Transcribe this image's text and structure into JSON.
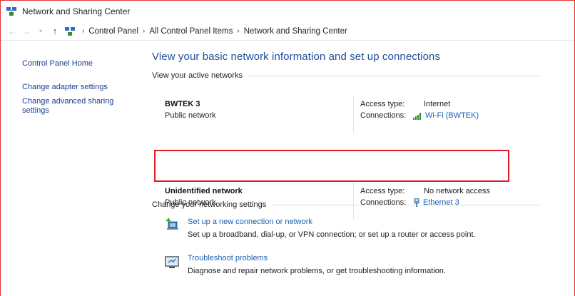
{
  "window": {
    "title": "Network and Sharing Center"
  },
  "address": {
    "crumbs": [
      "Control Panel",
      "All Control Panel Items",
      "Network and Sharing Center"
    ]
  },
  "sidebar": {
    "home": "Control Panel Home",
    "adapter": "Change adapter settings",
    "advanced_line1": "Change advanced sharing",
    "advanced_line2": "settings"
  },
  "main": {
    "title": "View your basic network information and set up connections",
    "active_heading": "View your active networks",
    "networks": [
      {
        "name": "BWTEK 3",
        "category": "Public network",
        "access_label": "Access type:",
        "access_value": "Internet",
        "connections_label": "Connections:",
        "connection_name": "Wi-Fi (BWTEK)",
        "connection_icon": "wifi-signal-icon"
      },
      {
        "name": "Unidentified network",
        "category": "Public network",
        "access_label": "Access type:",
        "access_value": "No network access",
        "connections_label": "Connections:",
        "connection_name": "Ethernet 3",
        "connection_icon": "ethernet-icon"
      }
    ],
    "change_heading": "Change your networking settings",
    "tasks": [
      {
        "title": "Set up a new connection or network",
        "desc": "Set up a broadband, dial-up, or VPN connection; or set up a router or access point.",
        "icon": "new-connection-icon"
      },
      {
        "title": "Troubleshoot problems",
        "desc": "Diagnose and repair network problems, or get troubleshooting information.",
        "icon": "troubleshoot-icon"
      }
    ]
  },
  "colors": {
    "link": "#1a5fb4",
    "title": "#1f4e9c",
    "highlight": "#e01b24"
  }
}
